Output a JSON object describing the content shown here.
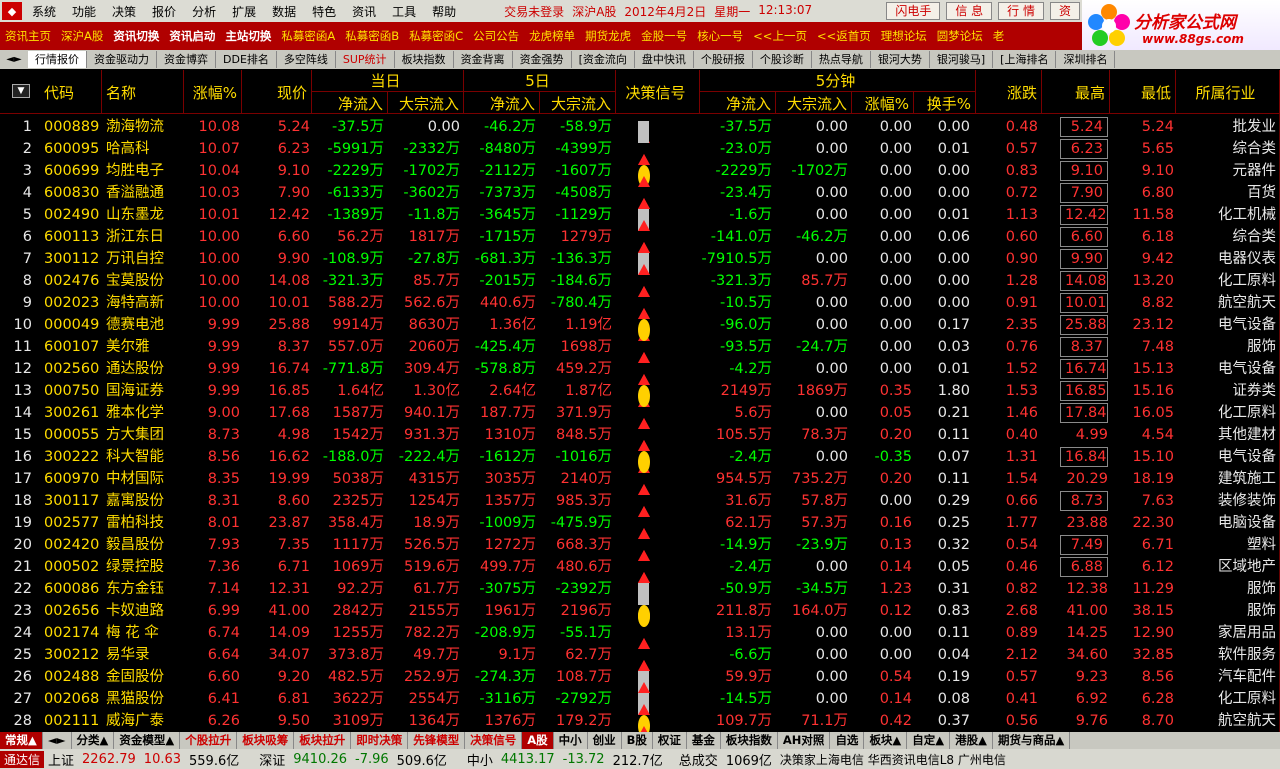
{
  "menubar": {
    "items": [
      "系统",
      "功能",
      "决策",
      "报价",
      "分析",
      "扩展",
      "数据",
      "特色",
      "资讯",
      "工具",
      "帮助"
    ],
    "status": [
      "交易未登录",
      "深沪A股",
      "2012年4月2日",
      "星期一",
      "12:13:07"
    ],
    "buttons": [
      "闪电手",
      "信 息",
      "行 情",
      "资"
    ]
  },
  "toolbar": {
    "items": [
      {
        "label": "资讯主页",
        "white": false
      },
      {
        "label": "深沪A股",
        "white": false
      },
      {
        "label": "资讯切换",
        "white": true
      },
      {
        "label": "资讯启动",
        "white": true
      },
      {
        "label": "主站切换",
        "white": true
      },
      {
        "label": "私募密函A",
        "white": false
      },
      {
        "label": "私募密函B",
        "white": false
      },
      {
        "label": "私募密函C",
        "white": false
      },
      {
        "label": "公司公告",
        "white": false
      },
      {
        "label": "龙虎榜单",
        "white": false
      },
      {
        "label": "期货龙虎",
        "white": false
      },
      {
        "label": "金股一号",
        "white": false
      },
      {
        "label": "核心一号",
        "white": false
      },
      {
        "label": "<<上一页",
        "white": false
      },
      {
        "label": "<<返首页",
        "white": false
      },
      {
        "label": "理想论坛",
        "white": false
      },
      {
        "label": "圆梦论坛",
        "white": false
      },
      {
        "label": "老",
        "white": false
      }
    ]
  },
  "banner": {
    "title": "分析家公式网",
    "url": "www.88gs.com"
  },
  "tabs": [
    {
      "label": "行情报价",
      "active": true,
      "red": false
    },
    {
      "label": "资金驱动力",
      "active": false,
      "red": false
    },
    {
      "label": "资金博弈",
      "active": false,
      "red": false
    },
    {
      "label": "DDE排名",
      "active": false,
      "red": false
    },
    {
      "label": "多空阵线",
      "active": false,
      "red": false
    },
    {
      "label": "SUP统计",
      "active": false,
      "red": true
    },
    {
      "label": "板块指数",
      "active": false,
      "red": false
    },
    {
      "label": "资金背离",
      "active": false,
      "red": false
    },
    {
      "label": "资金强势",
      "active": false,
      "red": false
    },
    {
      "label": "[资金流向",
      "active": false,
      "red": false
    },
    {
      "label": "盘中快讯",
      "active": false,
      "red": false
    },
    {
      "label": "个股研报",
      "active": false,
      "red": false
    },
    {
      "label": "个股诊断",
      "active": false,
      "red": false
    },
    {
      "label": "热点导航",
      "active": false,
      "red": false
    },
    {
      "label": "银河大势",
      "active": false,
      "red": false
    },
    {
      "label": "银河骏马]",
      "active": false,
      "red": false
    },
    {
      "label": "[上海排名",
      "active": false,
      "red": false
    },
    {
      "label": "深圳排名",
      "active": false,
      "red": false
    }
  ],
  "columns": {
    "code": "代码",
    "name": "名称",
    "change": "涨幅%",
    "price": "现价",
    "today": "当日",
    "five_day": "5日",
    "signal": "决策信号",
    "five_min": "5分钟",
    "net_inflow": "净流入",
    "block_inflow": "大宗流入",
    "pct": "涨幅%",
    "turnover": "换手%",
    "updown": "涨跌",
    "high": "最高",
    "low": "最低",
    "industry": "所属行业"
  },
  "rows": [
    {
      "n": "1",
      "code": "000889",
      "name": "渤海物流",
      "chg": "10.08",
      "price": "5.24",
      "d_net": "-37.5万",
      "d_blk": "0.00",
      "f_net": "-46.2万",
      "f_blk": "-58.9万",
      "s1": "tri",
      "s2": "sq",
      "m_net": "-37.5万",
      "m_blk": "0.00",
      "m_pct": "0.00",
      "m_to": "0.00",
      "ud": "0.48",
      "high": "5.24",
      "hbox": true,
      "low": "5.24",
      "ind": "批发业"
    },
    {
      "n": "2",
      "code": "600095",
      "name": "哈高科",
      "chg": "10.07",
      "price": "6.23",
      "d_net": "-5991万",
      "d_blk": "-2332万",
      "f_net": "-8480万",
      "f_blk": "-4399万",
      "s1": "tri",
      "s2": "tri",
      "m_net": "-23.0万",
      "m_blk": "0.00",
      "m_pct": "0.00",
      "m_to": "0.01",
      "ud": "0.57",
      "high": "6.23",
      "hbox": true,
      "low": "5.65",
      "ind": "综合类"
    },
    {
      "n": "3",
      "code": "600699",
      "name": "均胜电子",
      "chg": "10.04",
      "price": "9.10",
      "d_net": "-2229万",
      "d_blk": "-1702万",
      "f_net": "-2112万",
      "f_blk": "-1607万",
      "s1": "dot",
      "s2": "tri",
      "m_net": "-2229万",
      "m_blk": "-1702万",
      "m_pct": "0.00",
      "m_to": "0.00",
      "ud": "0.83",
      "high": "9.10",
      "hbox": true,
      "low": "9.10",
      "ind": "元器件"
    },
    {
      "n": "4",
      "code": "600830",
      "name": "香溢融通",
      "chg": "10.03",
      "price": "7.90",
      "d_net": "-6133万",
      "d_blk": "-3602万",
      "f_net": "-7373万",
      "f_blk": "-4508万",
      "s1": "tri",
      "s2": "tri",
      "m_net": "-23.4万",
      "m_blk": "0.00",
      "m_pct": "0.00",
      "m_to": "0.00",
      "ud": "0.72",
      "high": "7.90",
      "hbox": true,
      "low": "6.80",
      "ind": "百货"
    },
    {
      "n": "5",
      "code": "002490",
      "name": "山东墨龙",
      "chg": "10.01",
      "price": "12.42",
      "d_net": "-1389万",
      "d_blk": "-11.8万",
      "f_net": "-3645万",
      "f_blk": "-1129万",
      "s1": "sq",
      "s2": "tri",
      "m_net": "-1.6万",
      "m_blk": "0.00",
      "m_pct": "0.00",
      "m_to": "0.01",
      "ud": "1.13",
      "high": "12.42",
      "hbox": true,
      "low": "11.58",
      "ind": "化工机械"
    },
    {
      "n": "6",
      "code": "600113",
      "name": "浙江东日",
      "chg": "10.00",
      "price": "6.60",
      "d_net": "56.2万",
      "d_blk": "1817万",
      "f_net": "-1715万",
      "f_blk": "1279万",
      "s1": "tri",
      "s2": "tri",
      "m_net": "-141.0万",
      "m_blk": "-46.2万",
      "m_pct": "0.00",
      "m_to": "0.06",
      "ud": "0.60",
      "high": "6.60",
      "hbox": true,
      "low": "6.18",
      "ind": "综合类"
    },
    {
      "n": "7",
      "code": "300112",
      "name": "万讯自控",
      "chg": "10.00",
      "price": "9.90",
      "d_net": "-108.9万",
      "d_blk": "-27.8万",
      "f_net": "-681.3万",
      "f_blk": "-136.3万",
      "s1": "sq",
      "s2": "tri",
      "m_net": "-7910.5万",
      "m_blk": "0.00",
      "m_pct": "0.00",
      "m_to": "0.00",
      "ud": "0.90",
      "high": "9.90",
      "hbox": true,
      "low": "9.42",
      "ind": "电器仪表"
    },
    {
      "n": "8",
      "code": "002476",
      "name": "宝莫股份",
      "chg": "10.00",
      "price": "14.08",
      "d_net": "-321.3万",
      "d_blk": "85.7万",
      "f_net": "-2015万",
      "f_blk": "-184.6万",
      "s1": "tri",
      "s2": "tri",
      "m_net": "-321.3万",
      "m_blk": "85.7万",
      "m_pct": "0.00",
      "m_to": "0.00",
      "ud": "1.28",
      "high": "14.08",
      "hbox": true,
      "low": "13.20",
      "ind": "化工原料"
    },
    {
      "n": "9",
      "code": "002023",
      "name": "海特高新",
      "chg": "10.00",
      "price": "10.01",
      "d_net": "588.2万",
      "d_blk": "562.6万",
      "f_net": "440.6万",
      "f_blk": "-780.4万",
      "s1": "tri",
      "s2": "tri",
      "m_net": "-10.5万",
      "m_blk": "0.00",
      "m_pct": "0.00",
      "m_to": "0.00",
      "ud": "0.91",
      "high": "10.01",
      "hbox": true,
      "low": "8.82",
      "ind": "航空航天"
    },
    {
      "n": "10",
      "code": "000049",
      "name": "德赛电池",
      "chg": "9.99",
      "price": "25.88",
      "d_net": "9914万",
      "d_blk": "8630万",
      "f_net": "1.36亿",
      "f_blk": "1.19亿",
      "s1": "tri",
      "s2": "dot",
      "m_net": "-96.0万",
      "m_blk": "0.00",
      "m_pct": "0.00",
      "m_to": "0.17",
      "ud": "2.35",
      "high": "25.88",
      "hbox": true,
      "low": "23.12",
      "ind": "电气设备"
    },
    {
      "n": "11",
      "code": "600107",
      "name": "美尔雅",
      "chg": "9.99",
      "price": "8.37",
      "d_net": "557.0万",
      "d_blk": "2060万",
      "f_net": "-425.4万",
      "f_blk": "1698万",
      "s1": "tri",
      "s2": "tri",
      "m_net": "-93.5万",
      "m_blk": "-24.7万",
      "m_pct": "0.00",
      "m_to": "0.03",
      "ud": "0.76",
      "high": "8.37",
      "hbox": true,
      "low": "7.48",
      "ind": "服饰"
    },
    {
      "n": "12",
      "code": "002560",
      "name": "通达股份",
      "chg": "9.99",
      "price": "16.74",
      "d_net": "-771.8万",
      "d_blk": "309.4万",
      "f_net": "-578.8万",
      "f_blk": "459.2万",
      "s1": "tri",
      "s2": "tri",
      "m_net": "-4.2万",
      "m_blk": "0.00",
      "m_pct": "0.00",
      "m_to": "0.01",
      "ud": "1.52",
      "high": "16.74",
      "hbox": true,
      "low": "15.13",
      "ind": "电气设备"
    },
    {
      "n": "13",
      "code": "000750",
      "name": "国海证券",
      "chg": "9.99",
      "price": "16.85",
      "d_net": "1.64亿",
      "d_blk": "1.30亿",
      "f_net": "2.64亿",
      "f_blk": "1.87亿",
      "s1": "tri",
      "s2": "dot",
      "m_net": "2149万",
      "m_blk": "1869万",
      "m_pct": "0.35",
      "m_to": "1.80",
      "ud": "1.53",
      "high": "16.85",
      "hbox": true,
      "low": "15.16",
      "ind": "证券类"
    },
    {
      "n": "14",
      "code": "300261",
      "name": "雅本化学",
      "chg": "9.00",
      "price": "17.68",
      "d_net": "1587万",
      "d_blk": "940.1万",
      "f_net": "187.7万",
      "f_blk": "371.9万",
      "s1": "tri",
      "s2": "tri",
      "m_net": "5.6万",
      "m_blk": "0.00",
      "m_pct": "0.05",
      "m_to": "0.21",
      "ud": "1.46",
      "high": "17.84",
      "hbox": true,
      "low": "16.05",
      "ind": "化工原料"
    },
    {
      "n": "15",
      "code": "000055",
      "name": "方大集团",
      "chg": "8.73",
      "price": "4.98",
      "d_net": "1542万",
      "d_blk": "931.3万",
      "f_net": "1310万",
      "f_blk": "848.5万",
      "s1": "tri",
      "s2": "tri",
      "m_net": "105.5万",
      "m_blk": "78.3万",
      "m_pct": "0.20",
      "m_to": "0.11",
      "ud": "0.40",
      "high": "4.99",
      "hbox": false,
      "low": "4.54",
      "ind": "其他建材"
    },
    {
      "n": "16",
      "code": "300222",
      "name": "科大智能",
      "chg": "8.56",
      "price": "16.62",
      "d_net": "-188.0万",
      "d_blk": "-222.4万",
      "f_net": "-1612万",
      "f_blk": "-1016万",
      "s1": "tri",
      "s2": "dot",
      "m_net": "-2.4万",
      "m_blk": "0.00",
      "m_pct": "-0.35",
      "m_to": "0.07",
      "ud": "1.31",
      "high": "16.84",
      "hbox": true,
      "low": "15.10",
      "ind": "电气设备"
    },
    {
      "n": "17",
      "code": "600970",
      "name": "中材国际",
      "chg": "8.35",
      "price": "19.99",
      "d_net": "5038万",
      "d_blk": "4315万",
      "f_net": "3035万",
      "f_blk": "2140万",
      "s1": "tri",
      "s2": "tri",
      "m_net": "954.5万",
      "m_blk": "735.2万",
      "m_pct": "0.20",
      "m_to": "0.11",
      "ud": "1.54",
      "high": "20.29",
      "hbox": false,
      "low": "18.19",
      "ind": "建筑施工"
    },
    {
      "n": "18",
      "code": "300117",
      "name": "嘉寓股份",
      "chg": "8.31",
      "price": "8.60",
      "d_net": "2325万",
      "d_blk": "1254万",
      "f_net": "1357万",
      "f_blk": "985.3万",
      "s1": "tri",
      "s2": "tri",
      "m_net": "31.6万",
      "m_blk": "57.8万",
      "m_pct": "0.00",
      "m_to": "0.29",
      "ud": "0.66",
      "high": "8.73",
      "hbox": true,
      "low": "7.63",
      "ind": "装修装饰"
    },
    {
      "n": "19",
      "code": "002577",
      "name": "雷柏科技",
      "chg": "8.01",
      "price": "23.87",
      "d_net": "358.4万",
      "d_blk": "18.9万",
      "f_net": "-1009万",
      "f_blk": "-475.9万",
      "s1": "tri",
      "s2": "tri",
      "m_net": "62.1万",
      "m_blk": "57.3万",
      "m_pct": "0.16",
      "m_to": "0.25",
      "ud": "1.77",
      "high": "23.88",
      "hbox": false,
      "low": "22.30",
      "ind": "电脑设备"
    },
    {
      "n": "20",
      "code": "002420",
      "name": "毅昌股份",
      "chg": "7.93",
      "price": "7.35",
      "d_net": "1117万",
      "d_blk": "526.5万",
      "f_net": "1272万",
      "f_blk": "668.3万",
      "s1": "tri",
      "s2": "tri",
      "m_net": "-14.9万",
      "m_blk": "-23.9万",
      "m_pct": "0.13",
      "m_to": "0.32",
      "ud": "0.54",
      "high": "7.49",
      "hbox": true,
      "low": "6.71",
      "ind": "塑料"
    },
    {
      "n": "21",
      "code": "000502",
      "name": "绿景控股",
      "chg": "7.36",
      "price": "6.71",
      "d_net": "1069万",
      "d_blk": "519.6万",
      "f_net": "499.7万",
      "f_blk": "480.6万",
      "s1": "tri",
      "s2": "tri",
      "m_net": "-2.4万",
      "m_blk": "0.00",
      "m_pct": "0.14",
      "m_to": "0.05",
      "ud": "0.46",
      "high": "6.88",
      "hbox": true,
      "low": "6.12",
      "ind": "区域地产"
    },
    {
      "n": "22",
      "code": "600086",
      "name": "东方金钰",
      "chg": "7.14",
      "price": "12.31",
      "d_net": "92.2万",
      "d_blk": "61.7万",
      "f_net": "-3075万",
      "f_blk": "-2392万",
      "s1": "sq",
      "s2": "sq",
      "m_net": "-50.9万",
      "m_blk": "-34.5万",
      "m_pct": "1.23",
      "m_to": "0.31",
      "ud": "0.82",
      "high": "12.38",
      "hbox": false,
      "low": "11.29",
      "ind": "服饰"
    },
    {
      "n": "23",
      "code": "002656",
      "name": "卡奴迪路",
      "chg": "6.99",
      "price": "41.00",
      "d_net": "2842万",
      "d_blk": "2155万",
      "f_net": "1961万",
      "f_blk": "2196万",
      "s1": "dot",
      "s2": "dot",
      "m_net": "211.8万",
      "m_blk": "164.0万",
      "m_pct": "0.12",
      "m_to": "0.83",
      "ud": "2.68",
      "high": "41.00",
      "hbox": false,
      "low": "38.15",
      "ind": "服饰"
    },
    {
      "n": "24",
      "code": "002174",
      "name": "梅 花 伞",
      "chg": "6.74",
      "price": "14.09",
      "d_net": "1255万",
      "d_blk": "782.2万",
      "f_net": "-208.9万",
      "f_blk": "-55.1万",
      "s1": "tri",
      "s2": "tri",
      "m_net": "13.1万",
      "m_blk": "0.00",
      "m_pct": "0.00",
      "m_to": "0.11",
      "ud": "0.89",
      "high": "14.25",
      "hbox": false,
      "low": "12.90",
      "ind": "家居用品"
    },
    {
      "n": "25",
      "code": "300212",
      "name": "易华录",
      "chg": "6.64",
      "price": "34.07",
      "d_net": "373.8万",
      "d_blk": "49.7万",
      "f_net": "9.1万",
      "f_blk": "62.7万",
      "s1": "tri",
      "s2": "tri",
      "m_net": "-6.6万",
      "m_blk": "0.00",
      "m_pct": "0.00",
      "m_to": "0.04",
      "ud": "2.12",
      "high": "34.60",
      "hbox": false,
      "low": "32.85",
      "ind": "软件服务"
    },
    {
      "n": "26",
      "code": "002488",
      "name": "金固股份",
      "chg": "6.60",
      "price": "9.20",
      "d_net": "482.5万",
      "d_blk": "252.9万",
      "f_net": "-274.3万",
      "f_blk": "108.7万",
      "s1": "sq",
      "s2": "tri",
      "m_net": "59.9万",
      "m_blk": "0.00",
      "m_pct": "0.54",
      "m_to": "0.19",
      "ud": "0.57",
      "high": "9.23",
      "hbox": false,
      "low": "8.56",
      "ind": "汽车配件"
    },
    {
      "n": "27",
      "code": "002068",
      "name": "黑猫股份",
      "chg": "6.41",
      "price": "6.81",
      "d_net": "3622万",
      "d_blk": "2554万",
      "f_net": "-3116万",
      "f_blk": "-2792万",
      "s1": "sq",
      "s2": "tri",
      "m_net": "-14.5万",
      "m_blk": "0.00",
      "m_pct": "0.14",
      "m_to": "0.08",
      "ud": "0.41",
      "high": "6.92",
      "hbox": false,
      "low": "6.28",
      "ind": "化工原料"
    },
    {
      "n": "28",
      "code": "002111",
      "name": "威海广泰",
      "chg": "6.26",
      "price": "9.50",
      "d_net": "3109万",
      "d_blk": "1364万",
      "f_net": "1376万",
      "f_blk": "179.2万",
      "s1": "dot",
      "s2": "tri",
      "m_net": "109.7万",
      "m_blk": "71.1万",
      "m_pct": "0.42",
      "m_to": "0.37",
      "ud": "0.56",
      "high": "9.76",
      "hbox": false,
      "low": "8.70",
      "ind": "航空航天"
    }
  ],
  "bottomtabs": [
    {
      "label": "常规▲",
      "cls": "sel"
    },
    {
      "label": "◄►",
      "cls": ""
    },
    {
      "label": "分类▲",
      "cls": ""
    },
    {
      "label": "资金模型▲",
      "cls": ""
    },
    {
      "label": "个股拉升",
      "cls": "red"
    },
    {
      "label": "板块吸筹",
      "cls": "red"
    },
    {
      "label": "板块拉升",
      "cls": "red"
    },
    {
      "label": "即时决策",
      "cls": "red"
    },
    {
      "label": "先锋模型",
      "cls": "red"
    },
    {
      "label": "决策信号",
      "cls": "red"
    },
    {
      "label": "A股",
      "cls": "sel"
    },
    {
      "label": "中小",
      "cls": ""
    },
    {
      "label": "创业",
      "cls": ""
    },
    {
      "label": "B股",
      "cls": ""
    },
    {
      "label": "权证",
      "cls": ""
    },
    {
      "label": "基金",
      "cls": ""
    },
    {
      "label": "板块指数",
      "cls": ""
    },
    {
      "label": "AH对照",
      "cls": ""
    },
    {
      "label": "自选",
      "cls": ""
    },
    {
      "label": "板块▲",
      "cls": ""
    },
    {
      "label": "自定▲",
      "cls": ""
    },
    {
      "label": "港股▲",
      "cls": ""
    },
    {
      "label": "期货与商品▲",
      "cls": ""
    }
  ],
  "statusbar": {
    "tag": "通达信",
    "sh_label": "上证",
    "sh_val": "2262.79",
    "sh_chg": "10.63",
    "sh_amt": "559.6亿",
    "sz_label": "深证",
    "sz_val": "9410.26",
    "sz_chg": "-7.96",
    "sz_amt": "509.6亿",
    "zx_label": "中小",
    "zx_val": "4413.17",
    "zx_chg": "-13.72",
    "zx_amt": "212.7亿",
    "vol_label": "总成交",
    "vol_val": "1069亿",
    "info": "决策家上海电信  华西资讯电信L8  广州电信"
  },
  "colors": {
    "up": "#ff3232",
    "down": "#00ff00",
    "header": "#ffdc00",
    "grid_line": "#7a0000"
  }
}
